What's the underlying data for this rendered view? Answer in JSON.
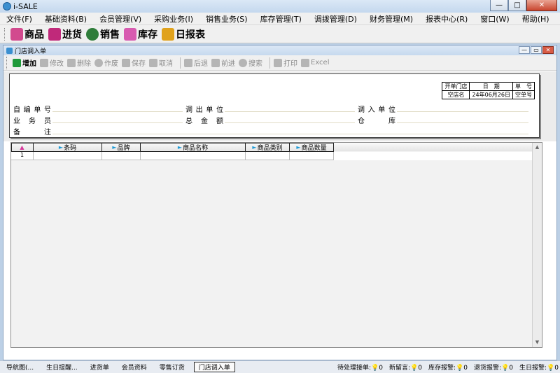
{
  "app": {
    "title": "i-SALE"
  },
  "window_buttons": {
    "minimize": "—",
    "maximize": "□",
    "close": "✕"
  },
  "menu": [
    "文件(F)",
    "基础资料(B)",
    "会员管理(V)",
    "采购业务(I)",
    "销售业务(S)",
    "库存管理(T)",
    "调拨管理(D)",
    "财务管理(M)",
    "报表中心(R)",
    "窗口(W)",
    "帮助(H)"
  ],
  "big_toolbar": [
    {
      "label": "商品",
      "icon": "goods-icon",
      "color": "#d24a8e"
    },
    {
      "label": "进货",
      "icon": "purchase-icon",
      "color": "#c0297a"
    },
    {
      "label": "销售",
      "icon": "sales-icon",
      "color": "#2f7d3a"
    },
    {
      "label": "库存",
      "icon": "inventory-icon",
      "color": "#d85bb0"
    },
    {
      "label": "日报表",
      "icon": "daily-report-icon",
      "color": "#e0a21c"
    }
  ],
  "child_window": {
    "title": "门店调入单",
    "min": "—",
    "restore": "▭",
    "close": "✕"
  },
  "toolbar": [
    {
      "label": "增加",
      "enabled": true,
      "icon": "add-icon"
    },
    {
      "label": "修改",
      "enabled": false,
      "icon": "edit-icon"
    },
    {
      "label": "删除",
      "enabled": false,
      "icon": "delete-icon"
    },
    {
      "label": "作废",
      "enabled": false,
      "icon": "void-icon"
    },
    {
      "label": "保存",
      "enabled": false,
      "icon": "save-icon"
    },
    {
      "label": "取消",
      "enabled": false,
      "icon": "undo-icon"
    },
    {
      "label": "后退",
      "enabled": false,
      "icon": "back-icon"
    },
    {
      "label": "前进",
      "enabled": false,
      "icon": "forward-icon"
    },
    {
      "label": "搜索",
      "enabled": false,
      "icon": "search-icon"
    },
    {
      "label": "打印",
      "enabled": false,
      "icon": "print-icon"
    },
    {
      "label": "Excel",
      "enabled": false,
      "icon": "excel-icon"
    }
  ],
  "info_box": {
    "store_label": "开单门店",
    "date_label": "日　期",
    "number_label": "单　号",
    "store": "空店名",
    "date": "24年06月26日",
    "number": "空单号"
  },
  "form": {
    "self_no": "自编单号",
    "out_unit": "调出单位",
    "in_unit": "调入单位",
    "salesman": "业务员",
    "total": "总金额",
    "warehouse": "仓库",
    "remark": "备注"
  },
  "grid": {
    "columns": [
      "条码",
      "品牌",
      "商品名称",
      "商品类别",
      "商品数量"
    ],
    "rows": [
      {
        "no": "1"
      }
    ]
  },
  "status_tabs": [
    "导航图(...",
    "生日提醒...",
    "进货单",
    "会员资料",
    "零售订货",
    "门店调入单"
  ],
  "status_right": [
    {
      "label": "待处理接单:",
      "value": "0"
    },
    {
      "label": "新留言:",
      "value": "0"
    },
    {
      "label": "库存报警:",
      "value": "0"
    },
    {
      "label": "退货报警:",
      "value": "0"
    },
    {
      "label": "生日报警:",
      "value": "0"
    }
  ]
}
